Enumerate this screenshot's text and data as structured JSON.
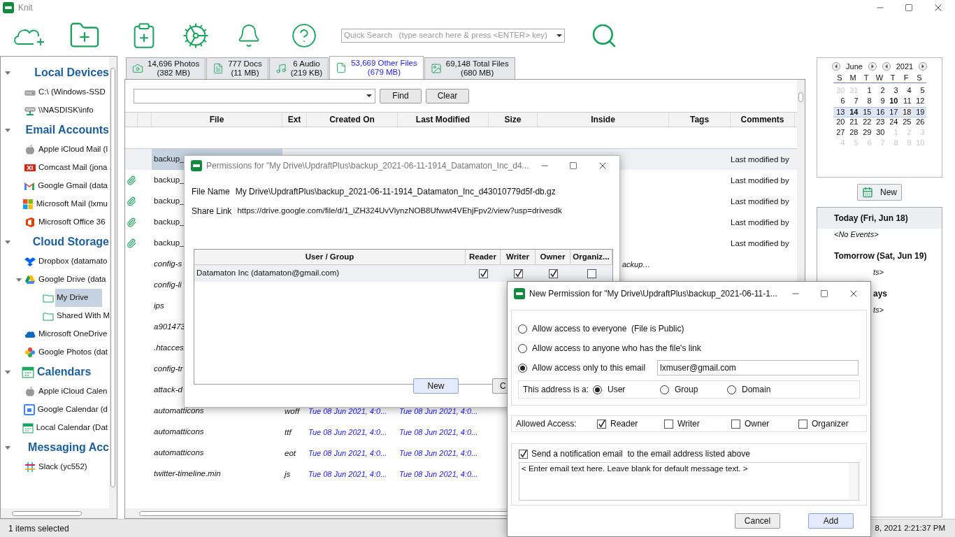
{
  "window": {
    "title": "Knit"
  },
  "quick_search": {
    "placeholder": "Quick Search   (type search here & press <ENTER> key)"
  },
  "sidebar": {
    "sections": [
      {
        "label": "Local Devices",
        "expanded": true,
        "children": [
          {
            "label": "C:\\ (Windows-SSD",
            "selected": false
          },
          {
            "label": "\\\\NASDISK\\info",
            "selected": false
          }
        ]
      },
      {
        "label": "Email Accounts",
        "expanded": true,
        "children": [
          {
            "label": "Apple iCloud Mail (l",
            "selected": false
          },
          {
            "label": "Comcast Mail (jona",
            "selected": false
          },
          {
            "label": "Google Gmail (data",
            "selected": false
          },
          {
            "label": "Microsoft Mail (lxmu",
            "selected": false
          },
          {
            "label": "Microsoft Office 36",
            "selected": false
          }
        ]
      },
      {
        "label": "Cloud Storage",
        "expanded": true,
        "children": [
          {
            "label": "Dropbox (datamato",
            "selected": false
          },
          {
            "label": "Google Drive (data",
            "selected": false,
            "expanded": true,
            "children": [
              {
                "label": "My Drive",
                "selected": true
              },
              {
                "label": "Shared With M",
                "selected": false
              }
            ]
          },
          {
            "label": "Microsoft OneDrive",
            "selected": false
          },
          {
            "label": "Google Photos (dat",
            "selected": false
          }
        ]
      },
      {
        "label": "Calendars",
        "expanded": true,
        "children": [
          {
            "label": "Apple iCloud Calen",
            "selected": false
          },
          {
            "label": "Google Calendar (d",
            "selected": false
          },
          {
            "label": "Local Calendar (Dat",
            "selected": false
          }
        ]
      },
      {
        "label": "Messaging Acc",
        "expanded": true,
        "children": [
          {
            "label": "Slack (yc552)",
            "selected": false
          }
        ]
      }
    ]
  },
  "tabs": [
    {
      "label": "14,696 Photos",
      "sub": "(382 MB)",
      "selected": false
    },
    {
      "label": "777 Docs",
      "sub": "(11 MB)",
      "selected": false
    },
    {
      "label": "6 Audio",
      "sub": "(219 KB)",
      "selected": false
    },
    {
      "label": "53,669 Other Files",
      "sub": "(679 MB)",
      "selected": true
    },
    {
      "label": "69,148 Total Files",
      "sub": "(680 MB)",
      "selected": false
    }
  ],
  "find_bar": {
    "find": "Find",
    "clear": "Clear"
  },
  "table": {
    "columns": [
      "File",
      "Ext",
      "Created On",
      "Last Modified",
      "Size",
      "Inside",
      "Tags",
      "Comments"
    ],
    "rows": [
      {
        "file": "backup_",
        "attachment": false,
        "italic": false,
        "selected": true,
        "comments": "Last modified by"
      },
      {
        "file": "backup_",
        "attachment": true,
        "italic": false,
        "selected": false,
        "comments": "Last modified by"
      },
      {
        "file": "backup_",
        "attachment": true,
        "italic": false,
        "selected": false,
        "comments": "Last modified by"
      },
      {
        "file": "backup_",
        "attachment": true,
        "italic": false,
        "selected": false,
        "comments": "Last modified by"
      },
      {
        "file": "backup_",
        "attachment": true,
        "italic": false,
        "selected": false,
        "comments": "Last modified by"
      },
      {
        "file": "config-s",
        "attachment": false,
        "italic": true,
        "selected": false,
        "inside": "ackup…"
      },
      {
        "file": "config-li",
        "attachment": false,
        "italic": true,
        "selected": false
      },
      {
        "file": "ips",
        "attachment": false,
        "italic": true,
        "selected": false
      },
      {
        "file": "a901473",
        "attachment": false,
        "italic": true,
        "selected": false
      },
      {
        "file": ".htacces",
        "attachment": false,
        "italic": true,
        "selected": false
      },
      {
        "file": "config-tr",
        "attachment": false,
        "italic": true,
        "selected": false
      },
      {
        "file": "attack-d",
        "attachment": false,
        "italic": true,
        "selected": false
      },
      {
        "file": "automatticons",
        "ext": "woff",
        "created": "Tue 08 Jun 2021, 4:0...",
        "modified": "Tue 08 Jun 2021, 4:0...",
        "attachment": false,
        "italic": true,
        "selected": false
      },
      {
        "file": "automatticons",
        "ext": "ttf",
        "created": "Tue 08 Jun 2021, 4:0...",
        "modified": "Tue 08 Jun 2021, 4:0...",
        "attachment": false,
        "italic": true,
        "selected": false
      },
      {
        "file": "automatticons",
        "ext": "eot",
        "created": "Tue 08 Jun 2021, 4:0...",
        "modified": "Tue 08 Jun 2021, 4:0...",
        "attachment": false,
        "italic": true,
        "selected": false
      },
      {
        "file": "twitter-timeline.min",
        "ext": "js",
        "created": "Tue 08 Jun 2021, 4:0...",
        "modified": "Tue 08 Jun 2021, 4:0...",
        "attachment": false,
        "italic": true,
        "selected": false
      }
    ]
  },
  "calendar": {
    "month": "June",
    "year": "2021",
    "weekdays": [
      "S",
      "M",
      "T",
      "W",
      "T",
      "F",
      "S"
    ],
    "weeks": [
      [
        {
          "d": "30",
          "muted": true,
          "bold": false,
          "selected": false,
          "today": false
        },
        {
          "d": "31",
          "muted": true,
          "bold": false,
          "selected": false,
          "today": false
        },
        {
          "d": "1",
          "muted": false,
          "bold": false,
          "selected": false,
          "today": false
        },
        {
          "d": "2",
          "muted": false,
          "bold": false,
          "selected": false,
          "today": false
        },
        {
          "d": "3",
          "muted": false,
          "bold": false,
          "selected": false,
          "today": false
        },
        {
          "d": "4",
          "muted": false,
          "bold": false,
          "selected": false,
          "today": false
        },
        {
          "d": "5",
          "muted": false,
          "bold": false,
          "selected": false,
          "today": false
        }
      ],
      [
        {
          "d": "6",
          "muted": false,
          "bold": false,
          "selected": false,
          "today": false
        },
        {
          "d": "7",
          "muted": false,
          "bold": false,
          "selected": false,
          "today": false
        },
        {
          "d": "8",
          "muted": false,
          "bold": false,
          "selected": false,
          "today": false
        },
        {
          "d": "9",
          "muted": false,
          "bold": false,
          "selected": false,
          "today": false
        },
        {
          "d": "10",
          "muted": false,
          "bold": true,
          "selected": false,
          "today": false
        },
        {
          "d": "11",
          "muted": false,
          "bold": false,
          "selected": false,
          "today": false
        },
        {
          "d": "12",
          "muted": false,
          "bold": false,
          "selected": false,
          "today": false
        }
      ],
      [
        {
          "d": "13",
          "muted": false,
          "bold": false,
          "selected": true,
          "today": false
        },
        {
          "d": "14",
          "muted": false,
          "bold": true,
          "selected": true,
          "today": false
        },
        {
          "d": "15",
          "muted": false,
          "bold": false,
          "selected": true,
          "today": false
        },
        {
          "d": "16",
          "muted": false,
          "bold": false,
          "selected": true,
          "today": false
        },
        {
          "d": "17",
          "muted": false,
          "bold": false,
          "selected": true,
          "today": false
        },
        {
          "d": "18",
          "muted": false,
          "bold": false,
          "selected": true,
          "today": true
        },
        {
          "d": "19",
          "muted": false,
          "bold": false,
          "selected": true,
          "today": false
        }
      ],
      [
        {
          "d": "20",
          "muted": false,
          "bold": false,
          "selected": false,
          "today": false
        },
        {
          "d": "21",
          "muted": false,
          "bold": false,
          "selected": false,
          "today": false
        },
        {
          "d": "22",
          "muted": false,
          "bold": false,
          "selected": false,
          "today": false
        },
        {
          "d": "23",
          "muted": false,
          "bold": false,
          "selected": false,
          "today": false
        },
        {
          "d": "24",
          "muted": false,
          "bold": false,
          "selected": false,
          "today": false
        },
        {
          "d": "25",
          "muted": false,
          "bold": false,
          "selected": false,
          "today": false
        },
        {
          "d": "26",
          "muted": false,
          "bold": false,
          "selected": false,
          "today": false
        }
      ],
      [
        {
          "d": "27",
          "muted": false,
          "bold": false,
          "selected": false,
          "today": false
        },
        {
          "d": "28",
          "muted": false,
          "bold": false,
          "selected": false,
          "today": false
        },
        {
          "d": "29",
          "muted": false,
          "bold": false,
          "selected": false,
          "today": false
        },
        {
          "d": "30",
          "muted": false,
          "bold": false,
          "selected": false,
          "today": false
        },
        {
          "d": "1",
          "muted": true,
          "bold": false,
          "selected": false,
          "today": false
        },
        {
          "d": "2",
          "muted": true,
          "bold": false,
          "selected": false,
          "today": false
        },
        {
          "d": "3",
          "muted": true,
          "bold": false,
          "selected": false,
          "today": false
        }
      ],
      [
        {
          "d": "4",
          "muted": true,
          "bold": false,
          "selected": false,
          "today": false
        },
        {
          "d": "5",
          "muted": true,
          "bold": false,
          "selected": false,
          "today": false
        },
        {
          "d": "6",
          "muted": true,
          "bold": false,
          "selected": false,
          "today": false
        },
        {
          "d": "7",
          "muted": true,
          "bold": false,
          "selected": false,
          "today": false
        },
        {
          "d": "8",
          "muted": true,
          "bold": false,
          "selected": false,
          "today": false
        },
        {
          "d": "9",
          "muted": true,
          "bold": false,
          "selected": false,
          "today": false
        },
        {
          "d": "10",
          "muted": true,
          "bold": false,
          "selected": false,
          "today": false
        }
      ]
    ]
  },
  "new_event_button": "New",
  "agenda": [
    {
      "heading": "Today (Fri, Jun 18)",
      "highlighted": true,
      "events": [
        "<No Events>"
      ]
    },
    {
      "heading": "Tomorrow (Sat, Jun 19)",
      "highlighted": false,
      "events": [
        "ts>"
      ]
    },
    {
      "heading": "ays",
      "highlighted": false,
      "events": [
        "ts>"
      ]
    }
  ],
  "status_bar": {
    "left": "1 items selected",
    "right": "8, 2021 2:21:37 PM"
  },
  "permissions_dialog": {
    "title": "Permissions for \"My Drive\\UpdraftPlus\\backup_2021-06-11-1914_Datamaton_Inc_d4...",
    "file_name_label": "File Name",
    "file_name": "My Drive\\UpdraftPlus\\backup_2021-06-11-1914_Datamaton_Inc_d43010779d5f-db.gz",
    "share_link_label": "Share Link",
    "share_link": "https://drive.google.com/file/d/1_iZH324UvVlynzNOB8Ufwwt4VEhjFpv2/view?usp=drivesdk",
    "columns": [
      "User / Group",
      "Reader",
      "Writer",
      "Owner",
      "Organiz..."
    ],
    "rows": [
      {
        "user": "Datamaton Inc (datamaton@gmail.com)",
        "reader": true,
        "writer": true,
        "owner": true,
        "organizer": false
      }
    ],
    "buttons": [
      "New",
      "C"
    ]
  },
  "new_permission_dialog": {
    "title": "New Permission for \"My Drive\\UpdraftPlus\\backup_2021-06-11-1...",
    "access_options": [
      {
        "label": "Allow access to everyone  (File is Public)",
        "selected": false
      },
      {
        "label": "Allow access to anyone who has the file's link",
        "selected": false
      },
      {
        "label": "Allow access only to this email",
        "selected": true
      }
    ],
    "email": "lxmuser@gmail.com",
    "address_type_label": "This address is a:",
    "address_types": [
      {
        "label": "User",
        "selected": true
      },
      {
        "label": "Group",
        "selected": false
      },
      {
        "label": "Domain",
        "selected": false
      }
    ],
    "allowed_access_label": "Allowed Access:",
    "roles": [
      {
        "label": "Reader",
        "checked": true
      },
      {
        "label": "Writer",
        "checked": false
      },
      {
        "label": "Owner",
        "checked": false
      },
      {
        "label": "Organizer",
        "checked": false
      }
    ],
    "notify": {
      "label": "Send a notification email  to the email address listed above",
      "checked": true
    },
    "message": "< Enter email text here. Leave blank for default message text. >",
    "buttons": [
      {
        "label": "Cancel",
        "default": false
      },
      {
        "label": "Add",
        "default": true
      }
    ]
  }
}
